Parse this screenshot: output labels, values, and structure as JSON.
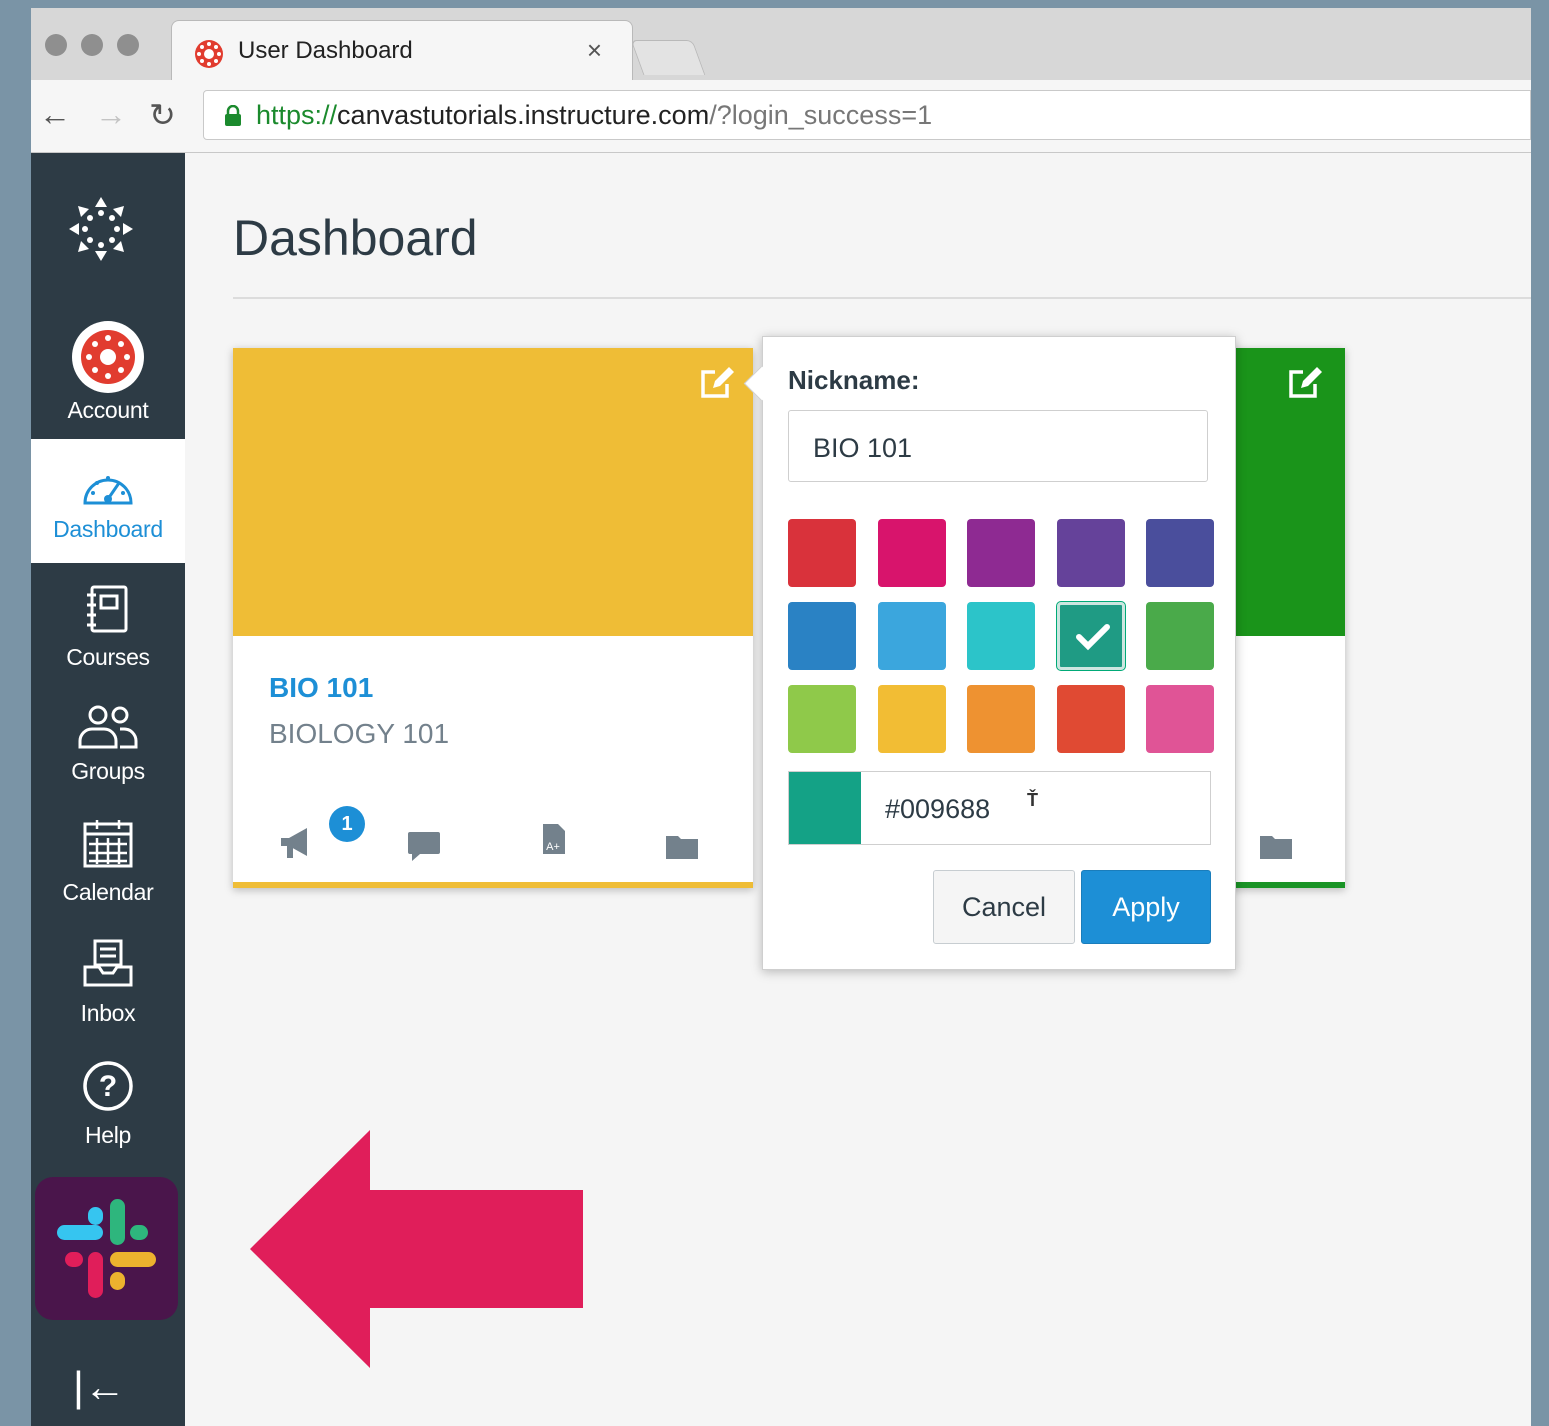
{
  "browser": {
    "tab_title": "User Dashboard",
    "tab_close": "×",
    "url_scheme": "https://",
    "url_host": "canvastutorials.instructure.com",
    "url_path": "/?login_success=1"
  },
  "sidebar": {
    "items": [
      {
        "label": "Account",
        "icon": "account-icon"
      },
      {
        "label": "Dashboard",
        "icon": "dashboard-icon"
      },
      {
        "label": "Courses",
        "icon": "courses-icon"
      },
      {
        "label": "Groups",
        "icon": "groups-icon"
      },
      {
        "label": "Calendar",
        "icon": "calendar-icon"
      },
      {
        "label": "Inbox",
        "icon": "inbox-icon"
      },
      {
        "label": "Help",
        "icon": "help-icon"
      }
    ],
    "collapse_glyph": "|←"
  },
  "page": {
    "title": "Dashboard"
  },
  "card": {
    "name": "BIO 101",
    "course": "BIOLOGY 101",
    "announcement_badge": "1",
    "color": "#efbd36"
  },
  "card2": {
    "color": "#1a941a"
  },
  "popover": {
    "nickname_label": "Nickname:",
    "nickname_value": "BIO 101",
    "swatches": [
      "#d9323b",
      "#d8146c",
      "#8e2a92",
      "#65429a",
      "#4a4e9c",
      "#2a82c4",
      "#3ba6dd",
      "#2cc4c9",
      "#1f9b84",
      "#4aaa4a",
      "#8fc94a",
      "#f2bd34",
      "#ee9231",
      "#e04a33",
      "#e05496"
    ],
    "selected_index": 8,
    "hex_value": "#009688",
    "hex_chip_color": "#14a286",
    "cancel_label": "Cancel",
    "apply_label": "Apply"
  },
  "colors": {
    "sidebar_bg": "#2d3b45",
    "accent_blue": "#1d8fd6",
    "slack_bg": "#4a154b",
    "callout_arrow": "#e01e5a"
  }
}
